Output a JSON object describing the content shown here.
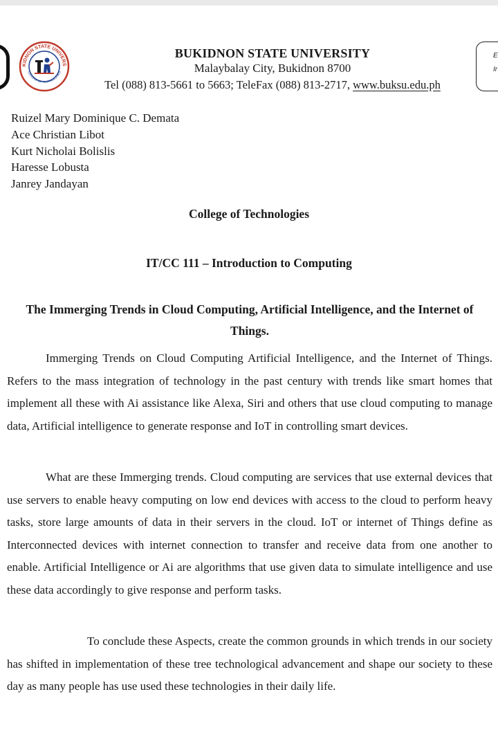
{
  "header": {
    "university_name": "BUKIDNON STATE UNIVERSITY",
    "address": "Malaybalay City, Bukidnon 8700",
    "contact_prefix": "Tel (088) 813-5661 to 5663; TeleFax (088) 813-2717, ",
    "website": "www.buksu.edu.ph",
    "seal_text_top": "BUKIDNON STATE UNIVERSITY",
    "seal_text_bottom": "COLLEGE OF TECHNOLOGIES",
    "corner_box": {
      "line1": "E",
      "line2": "Ir"
    }
  },
  "authors": [
    "Ruizel Mary Dominique C. Demata",
    "Ace Christian Libot",
    "Kurt Nicholai Bolislis",
    "Haresse Lobusta",
    "Janrey Jandayan"
  ],
  "college": "College of Technologies",
  "course": "IT/CC 111 – Introduction to Computing",
  "title": "The Immerging Trends in Cloud Computing, Artificial Intelligence, and the Internet of Things.",
  "paragraphs": [
    "Immerging Trends on Cloud Computing Artificial Intelligence, and the Internet of Things. Refers to the mass integration of technology in the past century with trends like smart homes that implement all these with Ai assistance like Alexa, Siri and others that use cloud computing to manage data, Artificial intelligence to generate response and IoT in controlling smart devices.",
    "What are these Immerging trends. Cloud computing are services that use external devices that use servers to enable heavy computing on low end devices with access to the cloud to perform heavy tasks, store large amounts of data in their servers in the cloud. IoT or internet of Things define as Interconnected devices with internet connection to transfer and receive data from one another to enable. Artificial Intelligence or Ai are algorithms that use given data to simulate intelligence and use these data accordingly to give response and perform tasks.",
    "To conclude these Aspects, create the common grounds in which trends in our society has shifted in implementation of these tree technological advancement and shape our society to these day as many people has use used these technologies in their daily life."
  ],
  "colors": {
    "seal_red": "#c0392b",
    "seal_blue": "#1f3f8f",
    "text": "#1a1a1a"
  }
}
